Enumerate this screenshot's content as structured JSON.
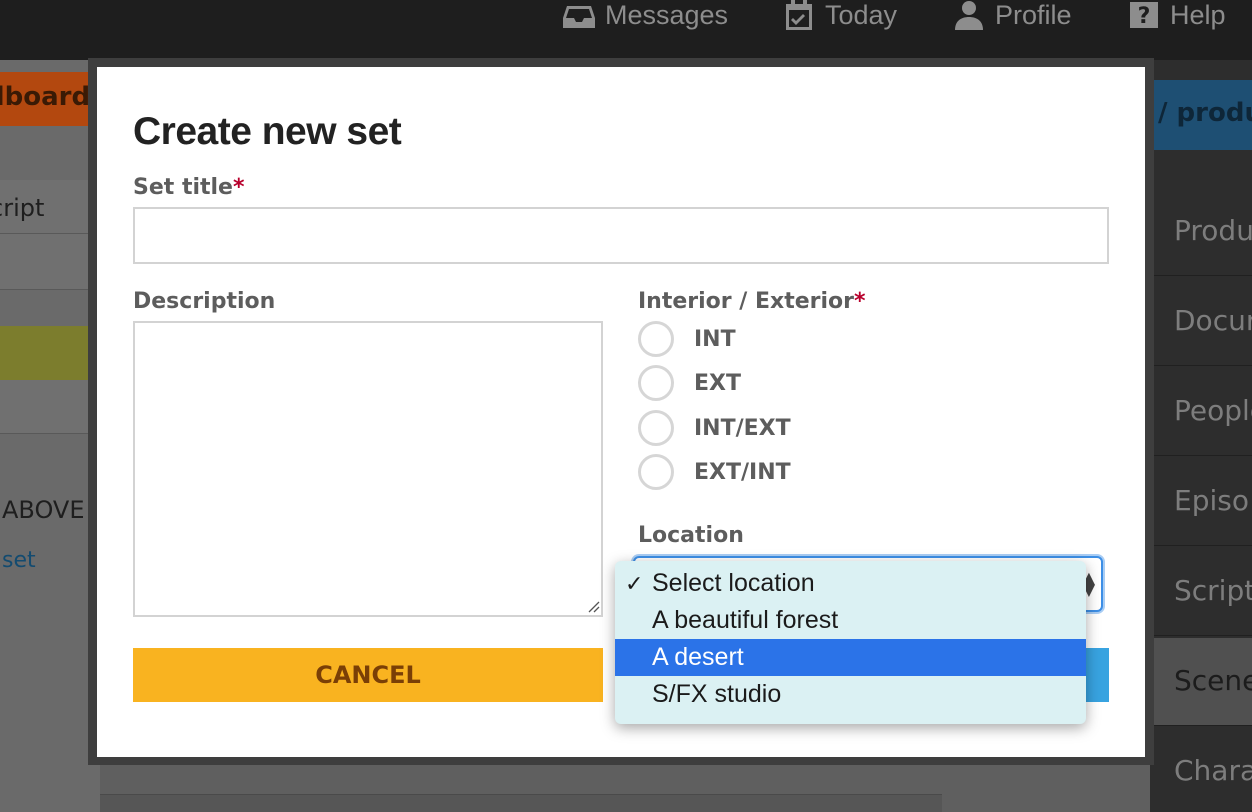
{
  "topnav": {
    "messages": "Messages",
    "today": "Today",
    "profile": "Profile",
    "help": "Help"
  },
  "bg_left": {
    "orange_tab": "dboard",
    "row_script": "cript",
    "row_t": "t",
    "caps": "ABOVE",
    "link": "set"
  },
  "bg_right": {
    "blue_tab": "/ product",
    "items": [
      "Produ",
      "Docur",
      "People",
      "Episo",
      "Scripts",
      "Scenes",
      "Chara"
    ]
  },
  "modal": {
    "title": "Create new set",
    "set_title_label": "Set title",
    "required_mark": "*",
    "set_title_value": "",
    "description_label": "Description",
    "description_value": "",
    "ie_label": "Interior / Exterior",
    "ie_options": [
      "INT",
      "EXT",
      "INT/EXT",
      "EXT/INT"
    ],
    "location_label": "Location",
    "location_selected": "Select location",
    "location_options": [
      "Select location",
      "A beautiful forest",
      "A desert",
      "S/FX studio"
    ],
    "location_highlighted": "A desert",
    "check_mark": "✓",
    "cancel_label": "CANCEL",
    "colors": {
      "cancel": "#f9b320",
      "save": "#38a3e0",
      "required": "#b8002c",
      "highlight": "#2b73e8"
    }
  }
}
